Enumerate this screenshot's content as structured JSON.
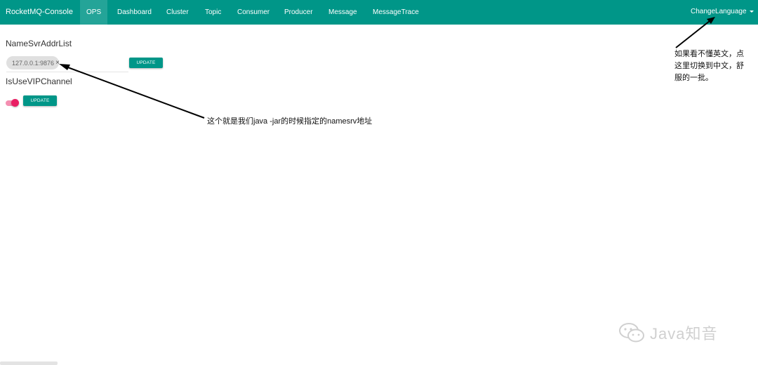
{
  "navbar": {
    "brand": "RocketMQ-Console",
    "items": [
      "OPS",
      "Dashboard",
      "Cluster",
      "Topic",
      "Consumer",
      "Producer",
      "Message",
      "MessageTrace"
    ],
    "language": "ChangeLanguage",
    "color": "#009688"
  },
  "namesrv": {
    "title": "NameSvrAddrList",
    "address": "127.0.0.1:9876",
    "close": "×",
    "update": "UPDATE"
  },
  "vip": {
    "title": "IsUseVIPChannel",
    "update": "UPDATE",
    "toggle_on": true
  },
  "annotations": {
    "namesrv_note": "这个就是我们java -jar的时候指定的namesrv地址",
    "language_note_lines": [
      "如果看不懂英文，点",
      "这里切换到中文，舒",
      "服的一批。"
    ]
  },
  "watermark": {
    "text": "Java知音",
    "icon": "wechat-icon"
  }
}
